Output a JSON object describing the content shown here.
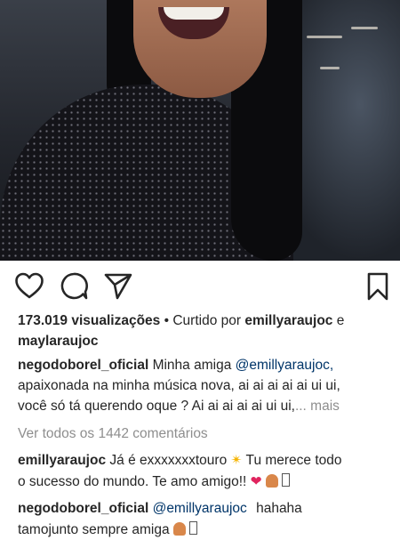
{
  "post": {
    "views_count": "173.019 visualizações",
    "liked_by_prefix": "• Curtido por",
    "liked_by_user1": "emillyaraujoc",
    "liked_and": "e",
    "liked_by_user2": "maylaraujoc"
  },
  "caption": {
    "username": "negodoborel_oficial",
    "text1": "Minha amiga",
    "mention": "@emillyaraujoc,",
    "text2": "apaixonada na minha música nova, ai ai ai ai ai ui ui,",
    "text3": "você só tá querendo oque ? Ai ai ai ai ai ui ui,",
    "more": "... mais"
  },
  "comments_link": "Ver todos os 1442 comentários",
  "comments": [
    {
      "username": "emillyaraujoc",
      "line1": "Já é exxxxxxxtouro",
      "line1b": "Tu merece todo",
      "line2": "o sucesso do mundo. Te amo amigo!!",
      "emojis": [
        "heart",
        "people"
      ]
    },
    {
      "username": "negodoborel_oficial",
      "mention": "@emillyaraujoc",
      "line1b": "hahaha",
      "line2": "tamojunto sempre amiga",
      "emojis": [
        "person"
      ]
    }
  ],
  "icons": {
    "like": "heart-outline-icon",
    "comment": "comment-bubble-icon",
    "share": "paper-plane-icon",
    "save": "bookmark-icon"
  }
}
